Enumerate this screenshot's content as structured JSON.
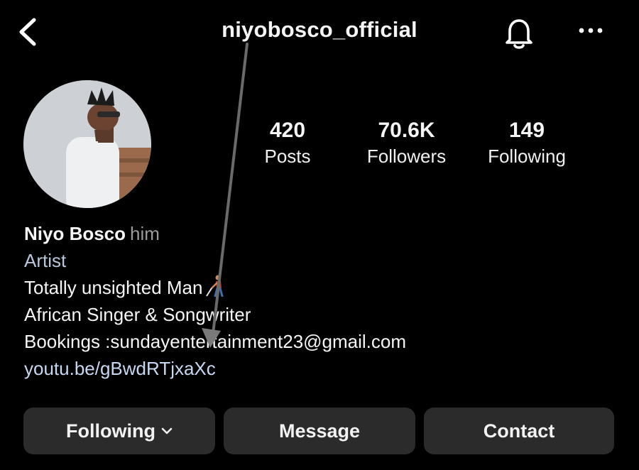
{
  "header": {
    "username": "niyobosco_official",
    "icons": {
      "back": "chevron-left-icon",
      "notifications": "bell-icon",
      "more": "more-horizontal-icon"
    }
  },
  "stats": [
    {
      "value": "420",
      "label": "Posts"
    },
    {
      "value": "70.6K",
      "label": "Followers"
    },
    {
      "value": "149",
      "label": "Following"
    }
  ],
  "bio": {
    "name": "Niyo Bosco",
    "pronouns": "him",
    "category": "Artist",
    "line1": "Totally unsighted Man",
    "line2": "African Singer & Songwriter",
    "line3": "Bookings :sundayentertainment23@gmail.com",
    "link": "youtu.be/gBwdRTjxaXc"
  },
  "actions": {
    "following_label": "Following",
    "message_label": "Message",
    "contact_label": "Contact"
  },
  "colors": {
    "background": "#000000",
    "button": "#2b2b2b",
    "link": "#c6d8f2",
    "category": "#b8c7db"
  }
}
